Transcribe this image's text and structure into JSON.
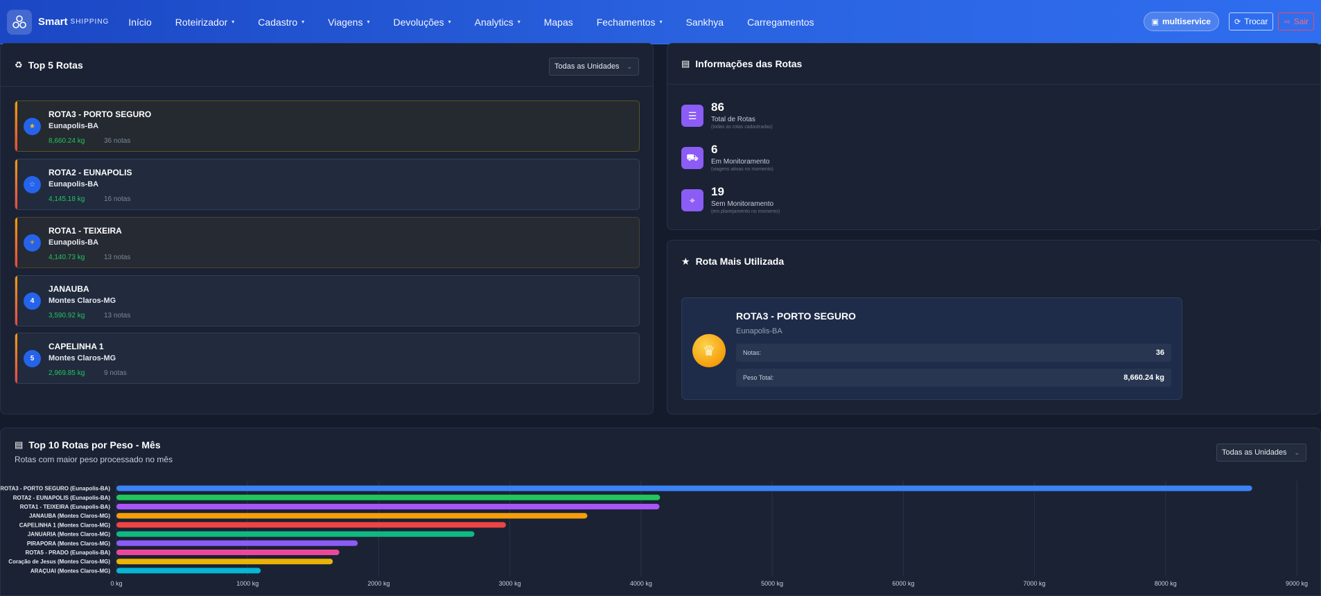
{
  "nav": {
    "brand_name": "Smart",
    "brand_sub": "SHIPPING",
    "items": [
      {
        "label": "Início",
        "dropdown": false
      },
      {
        "label": "Roteirizador",
        "dropdown": true
      },
      {
        "label": "Cadastro",
        "dropdown": true
      },
      {
        "label": "Viagens",
        "dropdown": true
      },
      {
        "label": "Devoluções",
        "dropdown": true
      },
      {
        "label": "Analytics",
        "dropdown": true
      },
      {
        "label": "Mapas",
        "dropdown": false
      },
      {
        "label": "Fechamentos",
        "dropdown": true
      },
      {
        "label": "Sankhya",
        "dropdown": false
      },
      {
        "label": "Carregamentos",
        "dropdown": false
      }
    ],
    "unit": "multiservice",
    "switch_label": "Trocar",
    "logout_label": "Sair"
  },
  "top5": {
    "title": "Top 5 Rotas",
    "filter": "Todas as Unidades",
    "routes": [
      {
        "rank": "1",
        "name": "ROTA3 - PORTO SEGURO",
        "city": "Eunapolis-BA",
        "weight": "8,660.24 kg",
        "notes": "36 notas"
      },
      {
        "rank": "2",
        "name": "ROTA2 - EUNAPOLIS",
        "city": "Eunapolis-BA",
        "weight": "4,145.18 kg",
        "notes": "16 notas"
      },
      {
        "rank": "3",
        "name": "ROTA1 - TEIXEIRA",
        "city": "Eunapolis-BA",
        "weight": "4,140.73 kg",
        "notes": "13 notas"
      },
      {
        "rank": "4",
        "name": "JANAUBA",
        "city": "Montes Claros-MG",
        "weight": "3,590.92 kg",
        "notes": "13 notas"
      },
      {
        "rank": "5",
        "name": "CAPELINHA 1",
        "city": "Montes Claros-MG",
        "weight": "2,969.85 kg",
        "notes": "9 notas"
      }
    ]
  },
  "info": {
    "title": "Informações das Rotas",
    "stats": [
      {
        "value": "86",
        "label": "Total de Rotas",
        "sub": "(todas as rotas cadastradas)",
        "icon": "list-icon"
      },
      {
        "value": "6",
        "label": "Em Monitoramento",
        "sub": "(viagens ativas no momento)",
        "icon": "truck-icon"
      },
      {
        "value": "19",
        "label": "Sem Monitoramento",
        "sub": "(em planejamento no momento)",
        "icon": "map-icon"
      }
    ]
  },
  "most_used": {
    "title": "Rota Mais Utilizada",
    "name": "ROTA3 - PORTO SEGURO",
    "city": "Eunapolis-BA",
    "notes_label": "Notas:",
    "notes_value": "36",
    "weight_label": "Peso Total:",
    "weight_value": "8,660.24 kg"
  },
  "chart_card": {
    "title": "Top 10 Rotas por Peso - Mês",
    "subtitle": "Rotas com maior peso processado no mês",
    "filter": "Todas as Unidades"
  },
  "chart_data": {
    "type": "bar",
    "orientation": "horizontal",
    "categories": [
      "ROTA3 - PORTO SEGURO (Eunapolis-BA)",
      "ROTA2 - EUNAPOLIS (Eunapolis-BA)",
      "ROTA1 - TEIXEIRA (Eunapolis-BA)",
      "JANAUBA (Montes Claros-MG)",
      "CAPELINHA 1 (Montes Claros-MG)",
      "JANUARIA (Montes Claros-MG)",
      "PIRAPORA (Montes Claros-MG)",
      "ROTA5 - PRADO (Eunapolis-BA)",
      "Coração de Jesus (Montes Claros-MG)",
      "ARAÇUAI (Montes Claros-MG)"
    ],
    "values": [
      8660.24,
      4145.18,
      4140.73,
      3590.92,
      2969.85,
      2730,
      1840,
      1700,
      1650,
      1100
    ],
    "colors": [
      "#3b82f6",
      "#22c55e",
      "#a855f7",
      "#f59e0b",
      "#ef4444",
      "#10b981",
      "#8b5cf6",
      "#ec4899",
      "#eab308",
      "#06b6d4"
    ],
    "xlim": [
      0,
      9000
    ],
    "xticks": [
      "0 kg",
      "1000 kg",
      "2000 kg",
      "3000 kg",
      "4000 kg",
      "5000 kg",
      "6000 kg",
      "7000 kg",
      "8000 kg",
      "9000 kg"
    ],
    "grid": true
  }
}
